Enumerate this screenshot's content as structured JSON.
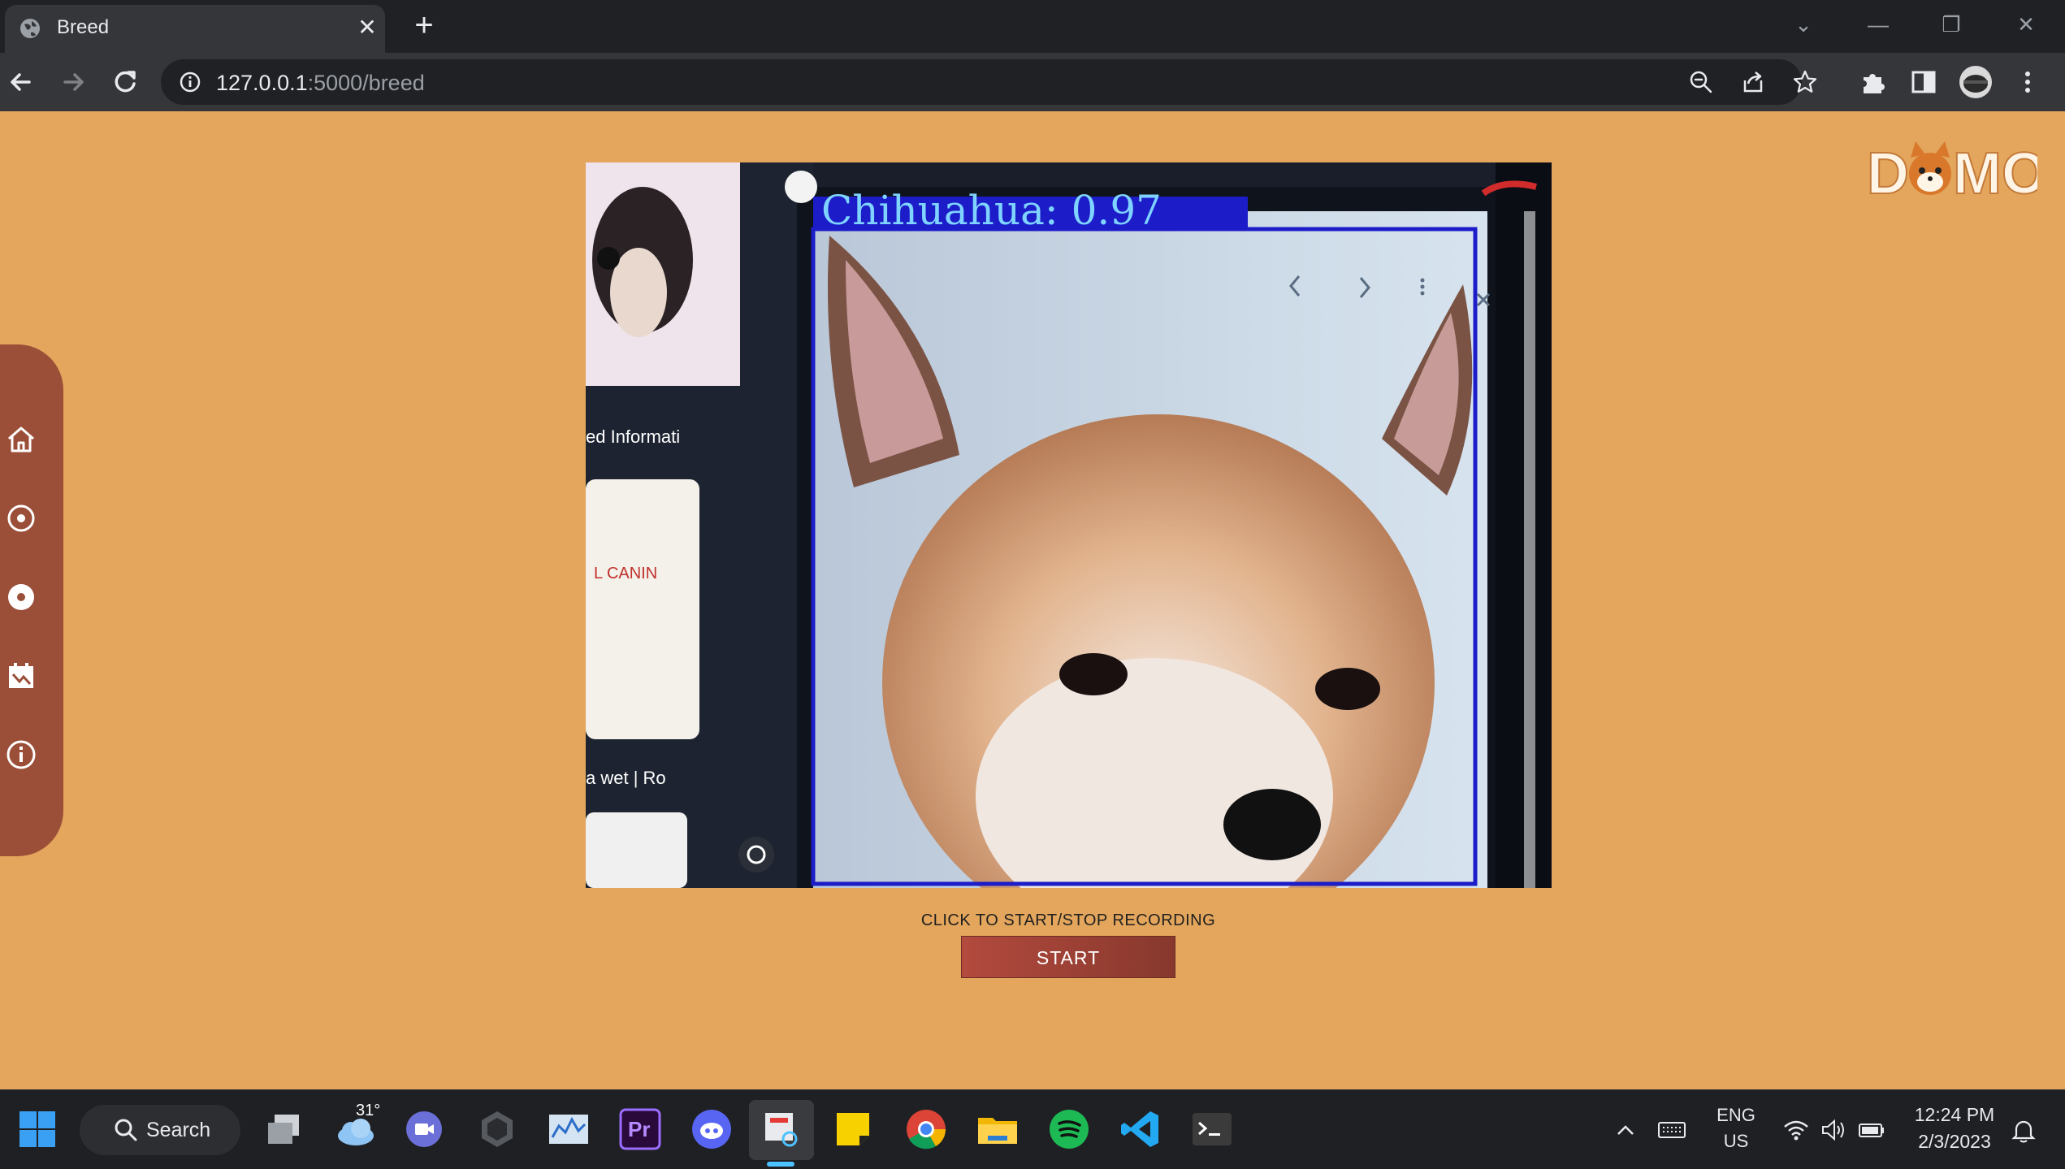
{
  "browser": {
    "tab_title": "Breed",
    "url_host": "127.0.0.1",
    "url_path": ":5000/breed"
  },
  "page": {
    "logo_text": "DOMO",
    "detection": {
      "label": "Chihuahua: 0.97",
      "background_text": [
        "ed Informati",
        "L CANIN",
        "a wet | Ro"
      ]
    },
    "record_prompt": "CLICK TO START/STOP RECORDING",
    "start_button": "START",
    "sidebar_icons": [
      "home-icon",
      "target-icon",
      "record-icon",
      "calendar-icon",
      "info-icon"
    ]
  },
  "taskbar": {
    "search_label": "Search",
    "weather_temp": "31°",
    "premiere_label": "Pr",
    "language": "ENG",
    "region": "US",
    "time": "12:24 PM",
    "date": "2/3/2023"
  },
  "colors": {
    "page_background": "#e3a65c",
    "sidebar": "#9b4f39",
    "start_button": "#b34a3e",
    "detection_box": "#1c1cc8"
  }
}
